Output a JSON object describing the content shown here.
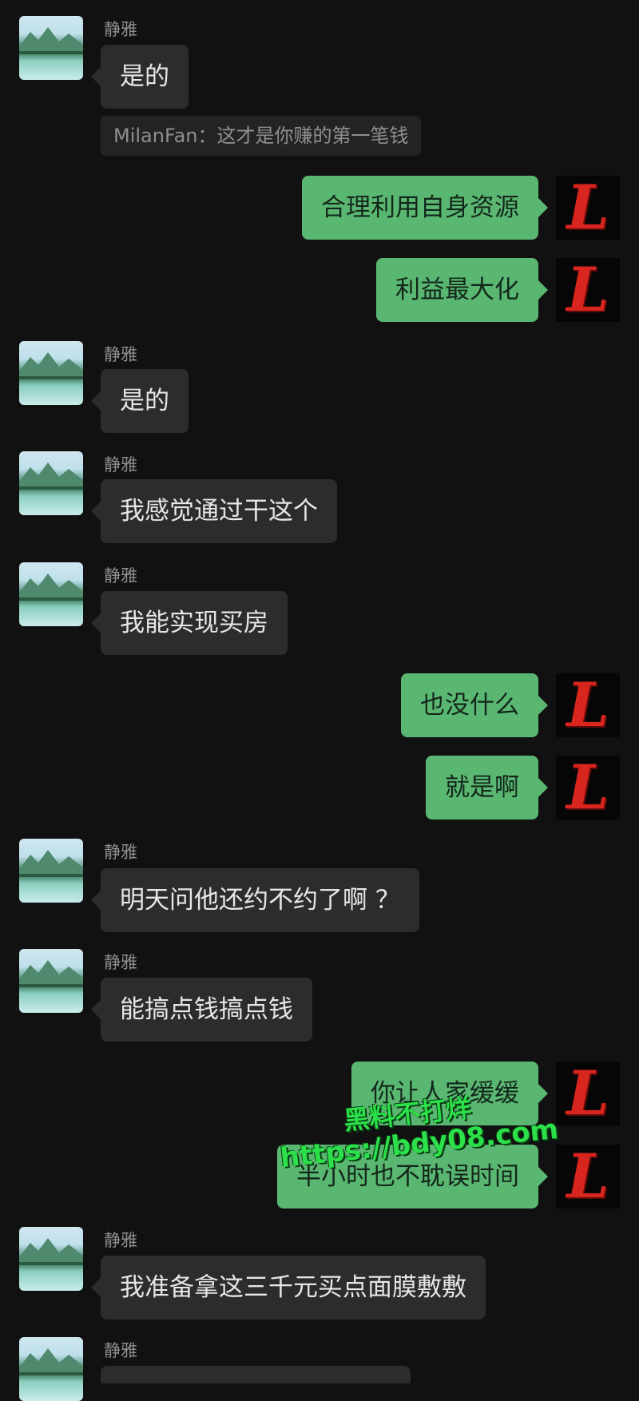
{
  "contact": {
    "name": "静雅"
  },
  "messages": {
    "m1": "是的",
    "quote": "MilanFan：这才是你赚的第一笔钱",
    "m2": "合理利用自身资源",
    "m3": "利益最大化",
    "m4": "是的",
    "m5": "我感觉通过干这个",
    "m6": "我能实现买房",
    "m7": "也没什么",
    "m8": "就是啊",
    "m9": "明天问他还约不约了啊 ？",
    "m10": "能搞点钱搞点钱",
    "m11": "你让人家缓缓",
    "m12": "半小时也不耽误时间",
    "m13": "我准备拿这三千元买点面膜敷敷"
  },
  "self_avatar_letter": "L",
  "watermark": {
    "line1": "黑料不打烊",
    "line2": "https://bdy08.com"
  },
  "colors": {
    "background": "#111111",
    "incoming": "#2c2c2c",
    "outgoing": "#59b772",
    "avatar_letter": "#d8251e"
  }
}
